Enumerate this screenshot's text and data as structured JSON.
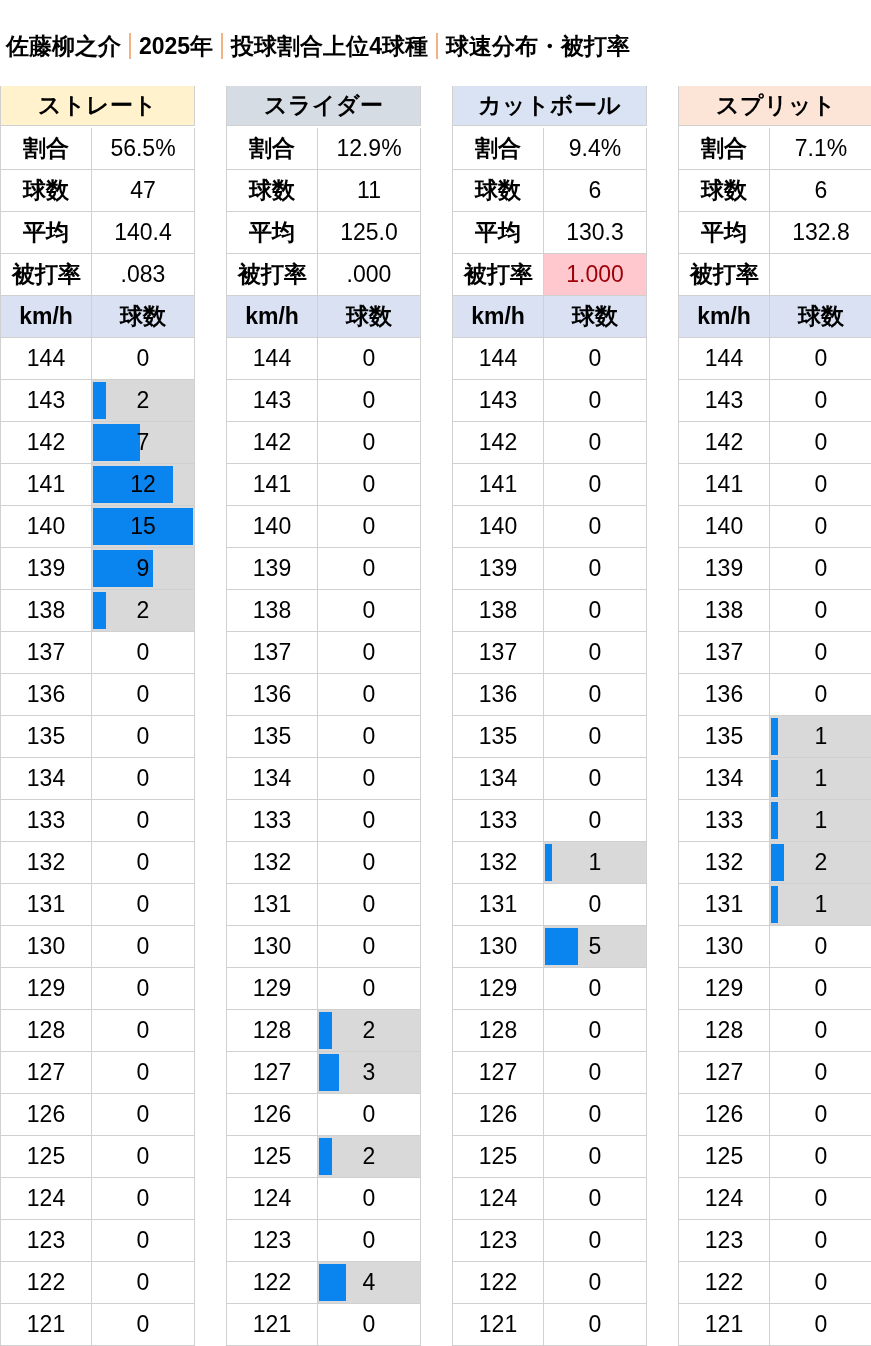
{
  "title": {
    "segments": [
      "佐藤柳之介",
      "2025年",
      "投球割合上位4球種",
      "球速分布・被打率"
    ]
  },
  "pitches": [
    {
      "name": "ストレート",
      "color": "#fff2cc",
      "stats": [
        {
          "label": "割合",
          "value": "56.5%",
          "highlighted": false
        },
        {
          "label": "球数",
          "value": "47",
          "highlighted": false
        },
        {
          "label": "平均",
          "value": "140.4",
          "highlighted": false
        },
        {
          "label": "被打率",
          "value": ".083",
          "highlighted": false
        }
      ],
      "columns": [
        "km/h",
        "球数"
      ],
      "rows": [
        {
          "speed": "144",
          "count": "0"
        },
        {
          "speed": "143",
          "count": "2",
          "level": 0.133
        },
        {
          "speed": "142",
          "count": "7",
          "level": 0.467
        },
        {
          "speed": "141",
          "count": "12",
          "level": 0.8
        },
        {
          "speed": "140",
          "count": "15",
          "level": 1
        },
        {
          "speed": "139",
          "count": "9",
          "level": 0.6
        },
        {
          "speed": "138",
          "count": "2",
          "level": 0.133
        },
        {
          "speed": "137",
          "count": "0"
        },
        {
          "speed": "136",
          "count": "0"
        },
        {
          "speed": "135",
          "count": "0"
        },
        {
          "speed": "134",
          "count": "0"
        },
        {
          "speed": "133",
          "count": "0"
        },
        {
          "speed": "132",
          "count": "0"
        },
        {
          "speed": "131",
          "count": "0"
        },
        {
          "speed": "130",
          "count": "0"
        },
        {
          "speed": "129",
          "count": "0"
        },
        {
          "speed": "128",
          "count": "0"
        },
        {
          "speed": "127",
          "count": "0"
        },
        {
          "speed": "126",
          "count": "0"
        },
        {
          "speed": "125",
          "count": "0"
        },
        {
          "speed": "124",
          "count": "0"
        },
        {
          "speed": "123",
          "count": "0"
        },
        {
          "speed": "122",
          "count": "0"
        },
        {
          "speed": "121",
          "count": "0"
        }
      ]
    },
    {
      "name": "スライダー",
      "color": "#d6dce4",
      "stats": [
        {
          "label": "割合",
          "value": "12.9%",
          "highlighted": false
        },
        {
          "label": "球数",
          "value": "11",
          "highlighted": false
        },
        {
          "label": "平均",
          "value": "125.0",
          "highlighted": false
        },
        {
          "label": "被打率",
          "value": ".000",
          "highlighted": false
        }
      ],
      "columns": [
        "km/h",
        "球数"
      ],
      "rows": [
        {
          "speed": "144",
          "count": "0"
        },
        {
          "speed": "143",
          "count": "0"
        },
        {
          "speed": "142",
          "count": "0"
        },
        {
          "speed": "141",
          "count": "0"
        },
        {
          "speed": "140",
          "count": "0"
        },
        {
          "speed": "139",
          "count": "0"
        },
        {
          "speed": "138",
          "count": "0"
        },
        {
          "speed": "137",
          "count": "0"
        },
        {
          "speed": "136",
          "count": "0"
        },
        {
          "speed": "135",
          "count": "0"
        },
        {
          "speed": "134",
          "count": "0"
        },
        {
          "speed": "133",
          "count": "0"
        },
        {
          "speed": "132",
          "count": "0"
        },
        {
          "speed": "131",
          "count": "0"
        },
        {
          "speed": "130",
          "count": "0"
        },
        {
          "speed": "129",
          "count": "0"
        },
        {
          "speed": "128",
          "count": "2",
          "level": 0.133
        },
        {
          "speed": "127",
          "count": "3",
          "level": 0.2
        },
        {
          "speed": "126",
          "count": "0"
        },
        {
          "speed": "125",
          "count": "2",
          "level": 0.133
        },
        {
          "speed": "124",
          "count": "0"
        },
        {
          "speed": "123",
          "count": "0"
        },
        {
          "speed": "122",
          "count": "4",
          "level": 0.267
        },
        {
          "speed": "121",
          "count": "0"
        }
      ]
    },
    {
      "name": "カットボール",
      "color": "#dae3f3",
      "stats": [
        {
          "label": "割合",
          "value": "9.4%",
          "highlighted": false
        },
        {
          "label": "球数",
          "value": "6",
          "highlighted": false
        },
        {
          "label": "平均",
          "value": "130.3",
          "highlighted": false
        },
        {
          "label": "被打率",
          "value": "1.000",
          "highlighted": true
        }
      ],
      "columns": [
        "km/h",
        "球数"
      ],
      "rows": [
        {
          "speed": "144",
          "count": "0"
        },
        {
          "speed": "143",
          "count": "0"
        },
        {
          "speed": "142",
          "count": "0"
        },
        {
          "speed": "141",
          "count": "0"
        },
        {
          "speed": "140",
          "count": "0"
        },
        {
          "speed": "139",
          "count": "0"
        },
        {
          "speed": "138",
          "count": "0"
        },
        {
          "speed": "137",
          "count": "0"
        },
        {
          "speed": "136",
          "count": "0"
        },
        {
          "speed": "135",
          "count": "0"
        },
        {
          "speed": "134",
          "count": "0"
        },
        {
          "speed": "133",
          "count": "0"
        },
        {
          "speed": "132",
          "count": "1",
          "level": 0.067
        },
        {
          "speed": "131",
          "count": "0"
        },
        {
          "speed": "130",
          "count": "5",
          "level": 0.333
        },
        {
          "speed": "129",
          "count": "0"
        },
        {
          "speed": "128",
          "count": "0"
        },
        {
          "speed": "127",
          "count": "0"
        },
        {
          "speed": "126",
          "count": "0"
        },
        {
          "speed": "125",
          "count": "0"
        },
        {
          "speed": "124",
          "count": "0"
        },
        {
          "speed": "123",
          "count": "0"
        },
        {
          "speed": "122",
          "count": "0"
        },
        {
          "speed": "121",
          "count": "0"
        }
      ]
    },
    {
      "name": "スプリット",
      "color": "#fce4d6",
      "stats": [
        {
          "label": "割合",
          "value": "7.1%",
          "highlighted": false
        },
        {
          "label": "球数",
          "value": "6",
          "highlighted": false
        },
        {
          "label": "平均",
          "value": "132.8",
          "highlighted": false
        },
        {
          "label": "被打率",
          "highlighted": false
        }
      ],
      "columns": [
        "km/h",
        "球数"
      ],
      "rows": [
        {
          "speed": "144",
          "count": "0"
        },
        {
          "speed": "143",
          "count": "0"
        },
        {
          "speed": "142",
          "count": "0"
        },
        {
          "speed": "141",
          "count": "0"
        },
        {
          "speed": "140",
          "count": "0"
        },
        {
          "speed": "139",
          "count": "0"
        },
        {
          "speed": "138",
          "count": "0"
        },
        {
          "speed": "137",
          "count": "0"
        },
        {
          "speed": "136",
          "count": "0"
        },
        {
          "speed": "135",
          "count": "1",
          "level": 0.067
        },
        {
          "speed": "134",
          "count": "1",
          "level": 0.067
        },
        {
          "speed": "133",
          "count": "1",
          "level": 0.067
        },
        {
          "speed": "132",
          "count": "2",
          "level": 0.133
        },
        {
          "speed": "131",
          "count": "1",
          "level": 0.067
        },
        {
          "speed": "130",
          "count": "0"
        },
        {
          "speed": "129",
          "count": "0"
        },
        {
          "speed": "128",
          "count": "0"
        },
        {
          "speed": "127",
          "count": "0"
        },
        {
          "speed": "126",
          "count": "0"
        },
        {
          "speed": "125",
          "count": "0"
        },
        {
          "speed": "124",
          "count": "0"
        },
        {
          "speed": "123",
          "count": "0"
        },
        {
          "speed": "122",
          "count": "0"
        },
        {
          "speed": "121",
          "count": "0"
        }
      ]
    }
  ]
}
